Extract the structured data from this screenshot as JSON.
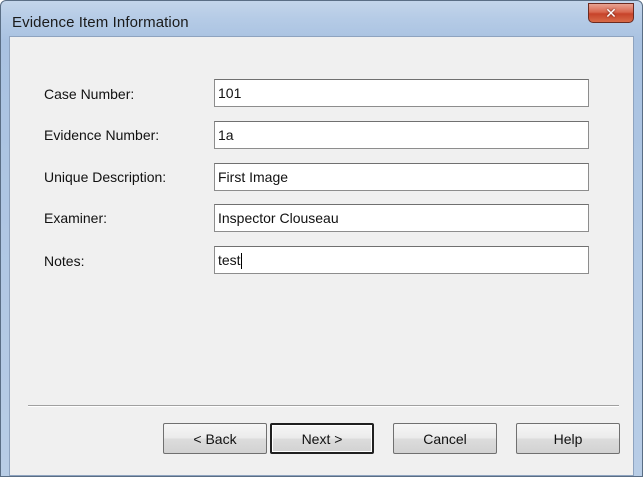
{
  "window": {
    "title": "Evidence Item Information",
    "close_glyph": "✕"
  },
  "form": {
    "fields": [
      {
        "label": "Case Number:",
        "value": "101"
      },
      {
        "label": "Evidence Number:",
        "value": "1a"
      },
      {
        "label": "Unique Description:",
        "value": "First Image"
      },
      {
        "label": "Examiner:",
        "value": "Inspector Clouseau"
      },
      {
        "label": "Notes:",
        "value": "test"
      }
    ]
  },
  "buttons": {
    "back": "< Back",
    "next": "Next >",
    "cancel": "Cancel",
    "help": "Help"
  }
}
